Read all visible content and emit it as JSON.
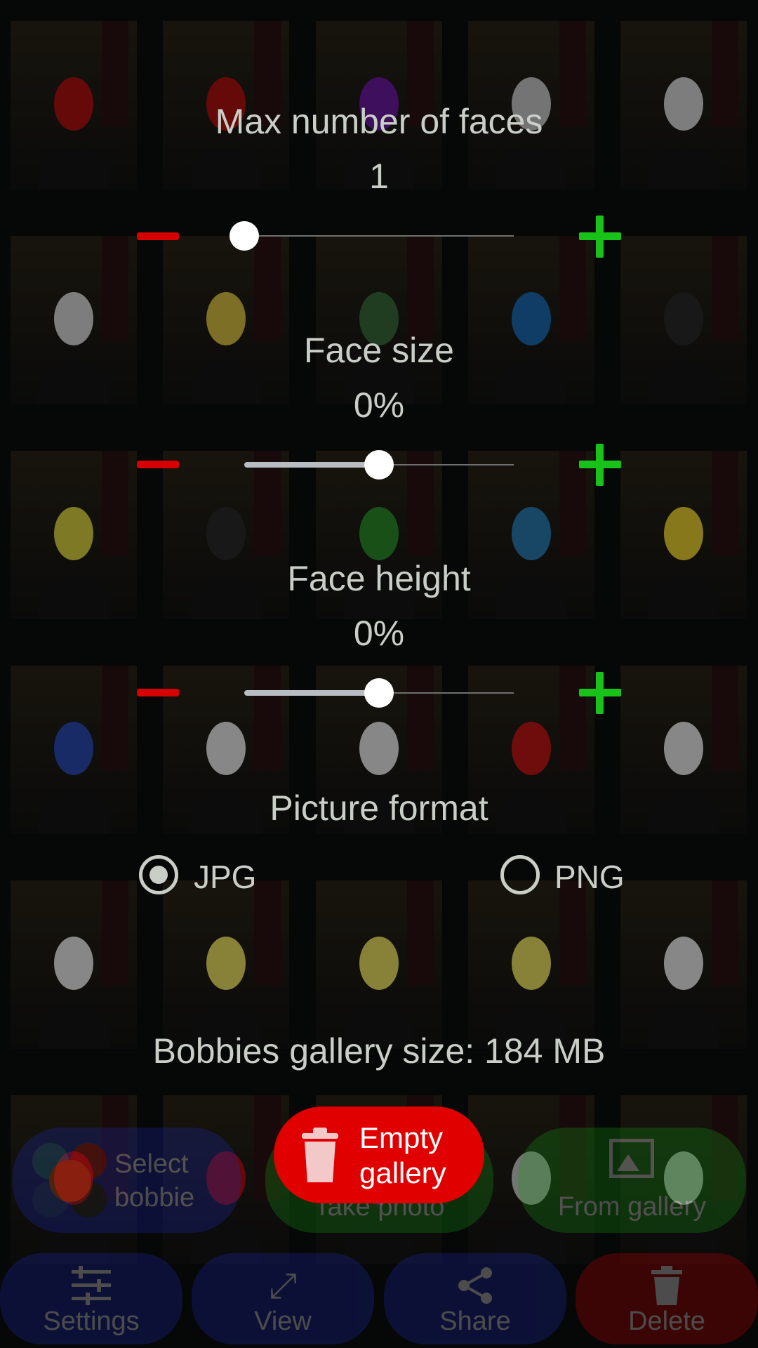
{
  "settings": {
    "max_faces": {
      "label": "Max number of faces",
      "value": "1",
      "level": 0
    },
    "face_size": {
      "label": "Face size",
      "value": "0%",
      "level": 0.5
    },
    "face_height": {
      "label": "Face height",
      "value": "0%",
      "level": 0.5
    },
    "picture_format": {
      "label": "Picture format",
      "options": [
        "JPG",
        "PNG"
      ],
      "selected": "JPG"
    }
  },
  "gallery": {
    "size_text": "Bobbies gallery size: 184 MB",
    "empty_label_line1": "Empty",
    "empty_label_line2": "gallery"
  },
  "actions": {
    "select_bobbie_line1": "Select",
    "select_bobbie_line2": "bobbie",
    "take_photo": "Take photo",
    "from_gallery": "From gallery"
  },
  "bottom_nav": {
    "settings": "Settings",
    "view": "View",
    "share": "Share",
    "delete": "Delete"
  },
  "colors": {
    "minus": "#d60000",
    "plus": "#19c219",
    "empty_button": "#e00000",
    "select_bobbie": "#1d2ab0",
    "take_photo": "#159a15",
    "from_gallery": "#159a15",
    "nav": "#1d2ab0",
    "delete": "#c80000"
  },
  "mask_colors": [
    "#b01010",
    "#b01010",
    "#6a1aa0",
    "#c8c8c8",
    "#d8d8d8",
    "#d8d8d8",
    "#d8c040",
    "#3a6a3a",
    "#1a6ab0",
    "#2a2a2a",
    "#d8d040",
    "#2a2a2a",
    "#2a8a2a",
    "#2a7ab0",
    "#e8d030",
    "#2a4ab0",
    "#e8e8e8",
    "#e8e8e8",
    "#c01818",
    "#e8e8e8",
    "#e8e8e8",
    "#e8e060",
    "#e8e060",
    "#e8e060",
    "#e8e8e8"
  ]
}
